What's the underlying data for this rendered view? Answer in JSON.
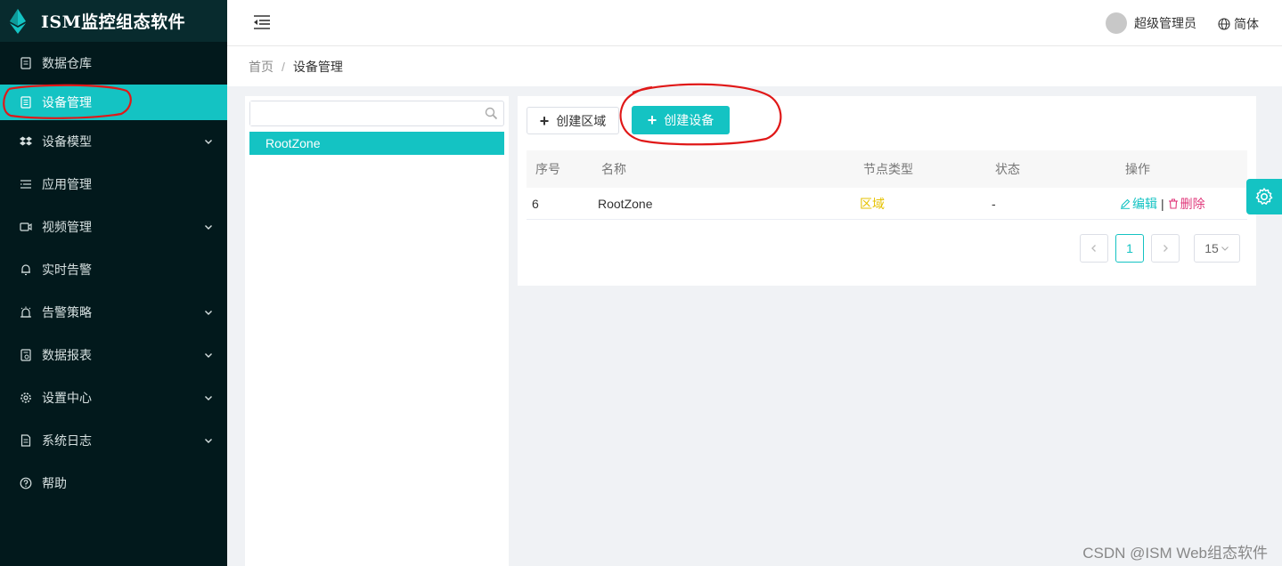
{
  "brand": {
    "title": "ISM监控组态软件"
  },
  "sidebar": {
    "items": [
      {
        "label": "数据仓库",
        "icon": "database-icon",
        "has_arrow": false,
        "active": false
      },
      {
        "label": "设备管理",
        "icon": "device-icon",
        "has_arrow": false,
        "active": true
      },
      {
        "label": "设备模型",
        "icon": "dropbox-icon",
        "has_arrow": true,
        "active": false
      },
      {
        "label": "应用管理",
        "icon": "list-icon",
        "has_arrow": false,
        "active": false
      },
      {
        "label": "视频管理",
        "icon": "video-icon",
        "has_arrow": true,
        "active": false
      },
      {
        "label": "实时告警",
        "icon": "bell-icon",
        "has_arrow": false,
        "active": false
      },
      {
        "label": "告警策略",
        "icon": "alarm-icon",
        "has_arrow": true,
        "active": false
      },
      {
        "label": "数据报表",
        "icon": "report-icon",
        "has_arrow": true,
        "active": false
      },
      {
        "label": "设置中心",
        "icon": "gear-icon",
        "has_arrow": true,
        "active": false
      },
      {
        "label": "系统日志",
        "icon": "log-icon",
        "has_arrow": true,
        "active": false
      },
      {
        "label": "帮助",
        "icon": "help-icon",
        "has_arrow": false,
        "active": false
      }
    ]
  },
  "header": {
    "user_name": "超级管理员",
    "language": "简体"
  },
  "breadcrumb": {
    "home": "首页",
    "separator": "/",
    "current": "设备管理"
  },
  "tree": {
    "search_placeholder": "",
    "nodes": [
      {
        "label": "RootZone"
      }
    ]
  },
  "toolbar": {
    "create_zone_label": "创建区域",
    "create_device_label": "创建设备",
    "plus": "+"
  },
  "table": {
    "columns": [
      "序号",
      "名称",
      "节点类型",
      "状态",
      "操作"
    ],
    "rows": [
      {
        "index": "6",
        "name": "RootZone",
        "type": "区域",
        "status": "-",
        "edit": "编辑",
        "delete": "删除",
        "sep": "|"
      }
    ]
  },
  "pager": {
    "current_page": "1",
    "page_size": "15"
  },
  "watermark": "CSDN @ISM Web组态软件",
  "colors": {
    "accent": "#14c3c3",
    "sidebar_bg": "#02191c",
    "zone_type": "#e6c200",
    "delete": "#e0387b",
    "annotation": "#e01818"
  }
}
